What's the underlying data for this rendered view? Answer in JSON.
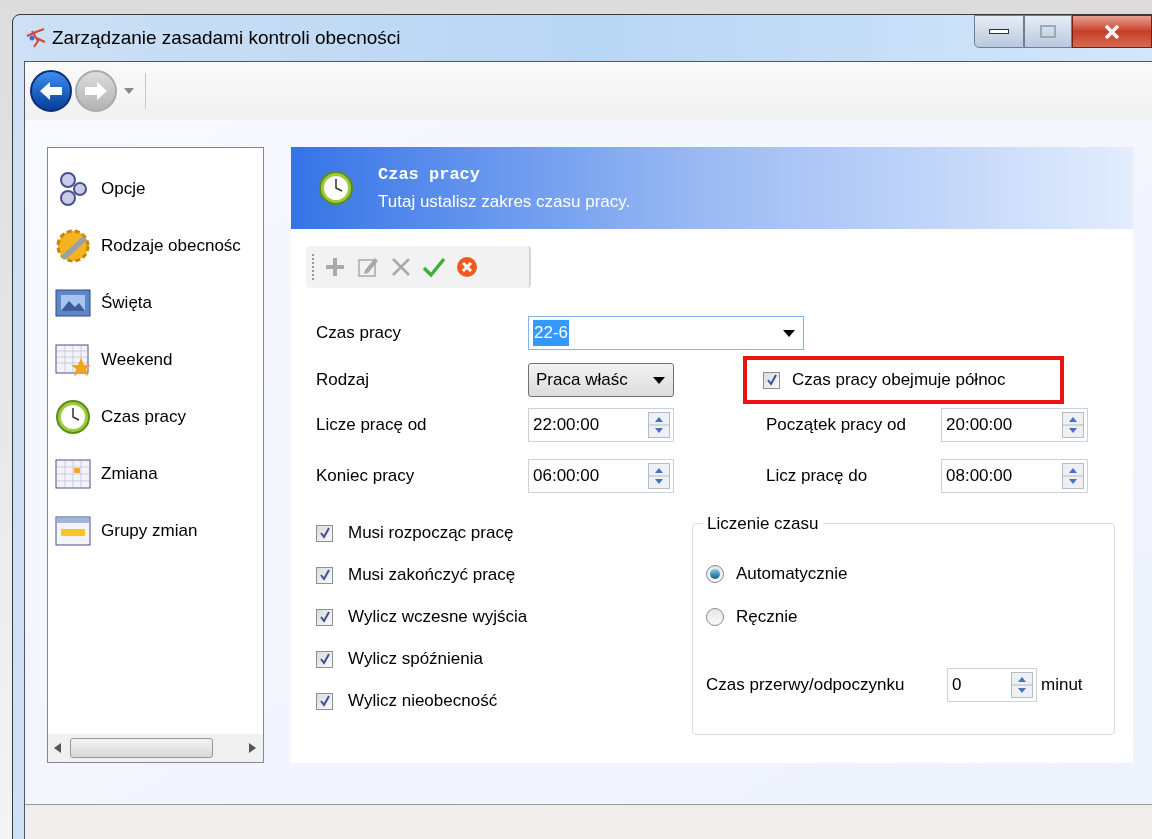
{
  "window": {
    "title": "Zarządzanie zasadami kontroli obecności"
  },
  "nav": {
    "back_disabled": false,
    "forward_disabled": true
  },
  "sidebar": {
    "items": [
      {
        "label": "Opcje"
      },
      {
        "label": "Rodzaje obecnośc"
      },
      {
        "label": "Święta"
      },
      {
        "label": "Weekend"
      },
      {
        "label": "Czas pracy"
      },
      {
        "label": "Zmiana"
      },
      {
        "label": "Grupy zmian"
      }
    ]
  },
  "header": {
    "title": "Czas pracy",
    "subtitle": "Tutaj ustalisz zakres czasu pracy."
  },
  "toolbar": [
    {
      "kind": "add",
      "disabled": true
    },
    {
      "kind": "edit",
      "disabled": true
    },
    {
      "kind": "delete",
      "disabled": true
    },
    {
      "kind": "confirm",
      "disabled": false
    },
    {
      "kind": "cancel",
      "disabled": false
    }
  ],
  "form": {
    "work_time": {
      "label": "Czas pracy",
      "value": "22-6"
    },
    "type": {
      "label": "Rodzaj",
      "value": "Praca właśc"
    },
    "midnight": {
      "label": "Czas pracy obejmuje północ",
      "checked": true,
      "highlighted": true
    },
    "start": {
      "label": "Licze pracę od",
      "value": "22:00:00"
    },
    "end": {
      "label": "Koniec pracy",
      "value": "06:00:00"
    },
    "start_from": {
      "label": "Początek pracy od",
      "value": "20:00:00"
    },
    "count_to": {
      "label": "Licz pracę do",
      "value": "08:00:00"
    }
  },
  "checkboxes": [
    {
      "label": "Musi rozpocząc pracę",
      "checked": true
    },
    {
      "label": "Musi zakończyć pracę",
      "checked": true
    },
    {
      "label": "Wylicz wczesne wyjścia",
      "checked": true
    },
    {
      "label": "Wylicz spóźnienia",
      "checked": true
    },
    {
      "label": "Wylicz nieobecność",
      "checked": true
    }
  ],
  "time_counting": {
    "title": "Liczenie czasu",
    "options": [
      {
        "label": "Automatycznie",
        "selected": true
      },
      {
        "label": "Ręcznie",
        "selected": false
      }
    ],
    "break": {
      "label": "Czas przerwy/odpoczynku",
      "value": "0",
      "unit": "minut"
    }
  }
}
